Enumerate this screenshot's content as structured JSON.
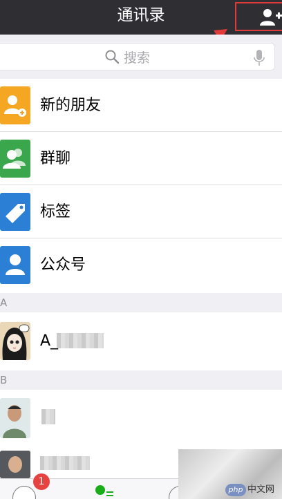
{
  "header": {
    "title": "通讯录"
  },
  "search": {
    "placeholder": "搜索"
  },
  "menu": [
    {
      "label": "新的朋友",
      "icon": "new-friend-icon",
      "color": "#f5a623"
    },
    {
      "label": "群聊",
      "icon": "group-chat-icon",
      "color": "#3aa74d"
    },
    {
      "label": "标签",
      "icon": "tag-icon",
      "color": "#2b7fd4"
    },
    {
      "label": "公众号",
      "icon": "official-account-icon",
      "color": "#2b7fd4"
    }
  ],
  "sections": [
    {
      "letter": "A",
      "contacts": [
        {
          "name": "A_"
        }
      ]
    },
    {
      "letter": "B"
    }
  ],
  "tabbar": {
    "badge": "1"
  },
  "watermark": {
    "logo": "php",
    "text": "中文网"
  },
  "colors": {
    "header_bg": "#2e2e33",
    "highlight_box": "#e2393b",
    "badge": "#e64340",
    "section_bg": "#efeff4"
  }
}
